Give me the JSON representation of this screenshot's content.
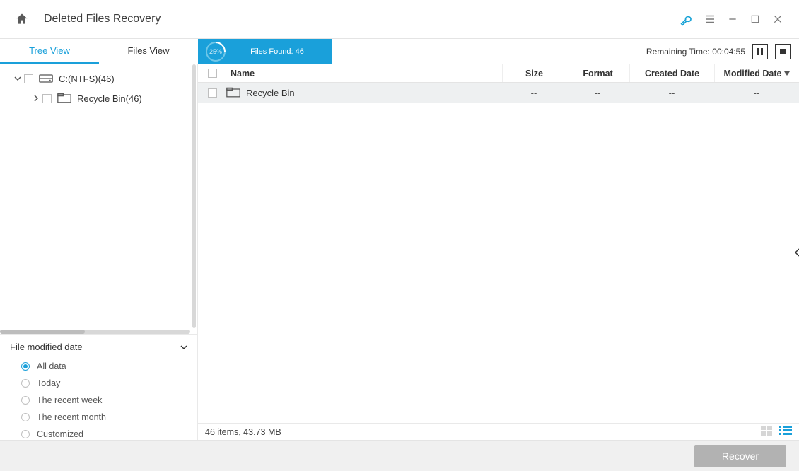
{
  "titlebar": {
    "title": "Deleted Files Recovery"
  },
  "subbar": {
    "tabs": {
      "tree": "Tree View",
      "files": "Files View"
    },
    "progress": {
      "percent": "25%",
      "found_label": "Files Found:  46"
    },
    "remaining": "Remaining Time: 00:04:55"
  },
  "tree": {
    "root": {
      "label": "C:(NTFS)(46)"
    },
    "child": {
      "label": "Recycle Bin(46)"
    }
  },
  "filter": {
    "heading": "File modified date",
    "options": {
      "all": "All data",
      "today": "Today",
      "week": "The recent week",
      "month": "The recent month",
      "custom": "Customized"
    }
  },
  "grid": {
    "headers": {
      "name": "Name",
      "size": "Size",
      "format": "Format",
      "created": "Created Date",
      "modified": "Modified Date"
    },
    "rows": [
      {
        "name": "Recycle Bin",
        "size": "--",
        "format": "--",
        "created": "--",
        "modified": "--"
      }
    ]
  },
  "status": {
    "summary": "46 items, 43.73 MB"
  },
  "footer": {
    "recover": "Recover"
  }
}
